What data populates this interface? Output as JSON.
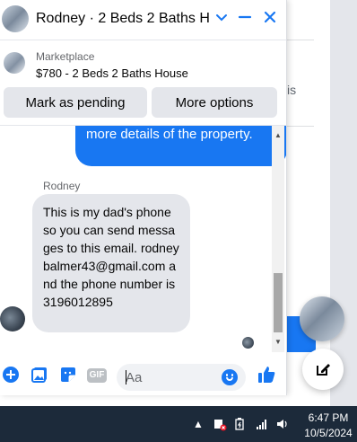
{
  "background": {
    "partial_text": "is"
  },
  "chat": {
    "header": {
      "title": "Rodney · 2 Beds 2 Baths H...",
      "minimize_glyph": "⌄",
      "dash_glyph": "—",
      "close_glyph": "✕"
    },
    "listing": {
      "label": "Marketplace",
      "title": "$780 - 2 Beds 2 Baths House",
      "mark_pending_label": "Mark as pending",
      "more_options_label": "More options"
    },
    "messages": {
      "outgoing_text": "more details of the property.",
      "sender_name": "Rodney",
      "incoming_text": "This is my dad's phone so you can send messages to this email. rodneybalmer43@gmail.com and the phone number is 3196012895"
    },
    "composer": {
      "placeholder": "Aa",
      "gif_label": "GIF"
    }
  },
  "taskbar": {
    "time": "6:47 PM",
    "date": "10/5/2024"
  },
  "colors": {
    "accent": "#1877f2",
    "bubble_incoming": "#e4e6eb",
    "taskbar": "#1c2a3a"
  },
  "icons": [
    "plus-circle-icon",
    "photo-icon",
    "sticker-icon",
    "gif-icon",
    "emoji-icon",
    "like-icon",
    "compose-icon",
    "chevron-down-icon",
    "minimize-icon",
    "close-icon",
    "chevron-up-icon",
    "wifi-icon",
    "volume-icon",
    "battery-icon",
    "notification-icon"
  ]
}
